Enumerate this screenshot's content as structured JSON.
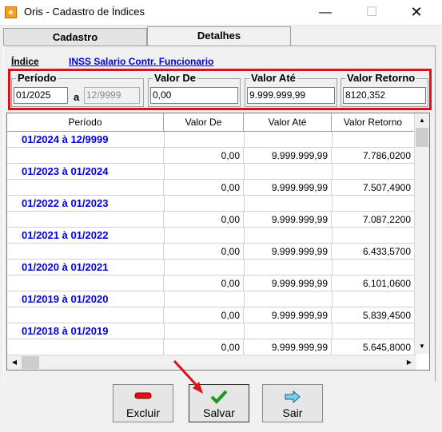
{
  "window": {
    "title": "Oris - Cadastro de Índices",
    "minimize": "—",
    "maximize": "☐",
    "close": "✕"
  },
  "tabs": [
    {
      "label": "Cadastro"
    },
    {
      "label": "Detalhes"
    }
  ],
  "indice": {
    "label": "Índice",
    "value": "INSS Salario Contr. Funcionario"
  },
  "form": {
    "periodo_label": "Período",
    "periodo_from": "01/2025",
    "periodo_sep": "a",
    "periodo_to": "12/9999",
    "valor_de_label": "Valor De",
    "valor_de": "0,00",
    "valor_ate_label": "Valor Até",
    "valor_ate": "9.999.999,99",
    "valor_retorno_label": "Valor Retorno",
    "valor_retorno": "8120,352"
  },
  "grid": {
    "columns": [
      "Período",
      "Valor De",
      "Valor Até",
      "Valor Retorno"
    ],
    "records": [
      {
        "period": "01/2024  à  12/9999",
        "valor_de": "0,00",
        "valor_ate": "9.999.999,99",
        "valor_retorno": "7.786,0200"
      },
      {
        "period": "01/2023  à  01/2024",
        "valor_de": "0,00",
        "valor_ate": "9.999.999,99",
        "valor_retorno": "7.507,4900"
      },
      {
        "period": "01/2022  à  01/2023",
        "valor_de": "0,00",
        "valor_ate": "9.999.999,99",
        "valor_retorno": "7.087,2200"
      },
      {
        "period": "01/2021  à  01/2022",
        "valor_de": "0,00",
        "valor_ate": "9.999.999,99",
        "valor_retorno": "6.433,5700"
      },
      {
        "period": "01/2020  à  01/2021",
        "valor_de": "0,00",
        "valor_ate": "9.999.999,99",
        "valor_retorno": "6.101,0600"
      },
      {
        "period": "01/2019  à  01/2020",
        "valor_de": "0,00",
        "valor_ate": "9.999.999,99",
        "valor_retorno": "5.839,4500"
      },
      {
        "period": "01/2018  à  01/2019",
        "valor_de": "0,00",
        "valor_ate": "9.999.999,99",
        "valor_retorno": "5.645,8000"
      }
    ]
  },
  "buttons": {
    "excluir": "Excluir",
    "salvar": "Salvar",
    "sair": "Sair"
  },
  "colors": {
    "highlight": "#e0101a",
    "period_text": "#0000e0",
    "indice_value": "#0000cc"
  },
  "icons": [
    "app-icon",
    "minus-icon",
    "checkmark-icon",
    "right-arrow-icon",
    "red-pointer-arrow"
  ]
}
